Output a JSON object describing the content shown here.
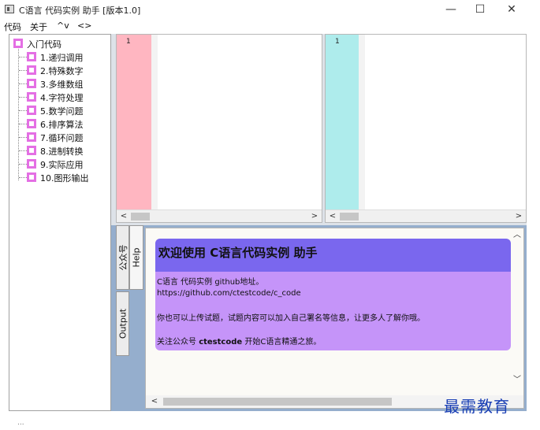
{
  "window": {
    "title": "C语言 代码实例 助手 [版本1.0]",
    "minimize_icon": "—",
    "maximize_icon": "☐",
    "close_icon": "✕"
  },
  "menu": {
    "items": [
      "代码",
      "关于",
      "^v",
      "<>"
    ]
  },
  "tree": {
    "root": "入门代码",
    "items": [
      "1.递归调用",
      "2.特殊数字",
      "3.多维数组",
      "4.字符处理",
      "5.数学问题",
      "6.排序算法",
      "7.循环问题",
      "8.进制转换",
      "9.实际应用",
      "10.图形输出"
    ]
  },
  "editors": {
    "left_line": "1",
    "right_line": "1",
    "scroll_left": "<",
    "scroll_right": ">"
  },
  "tabs": {
    "gzh": "公众号",
    "help": "Help",
    "output": "Output"
  },
  "help": {
    "title": "欢迎使用 C语言代码实例 助手",
    "line1": "C语言 代码实例 github地址。",
    "line2": "https://github.com/ctestcode/c_code",
    "line3": "你也可以上传试题，试题内容可以加入自己署名等信息，让更多人了解你哦。",
    "line4_pre": "关注公众号 ",
    "line4_bold": "ctestcode",
    "line4_post": " 开始C语言精通之旅。"
  },
  "watermark": "最需教育",
  "footer": "..."
}
